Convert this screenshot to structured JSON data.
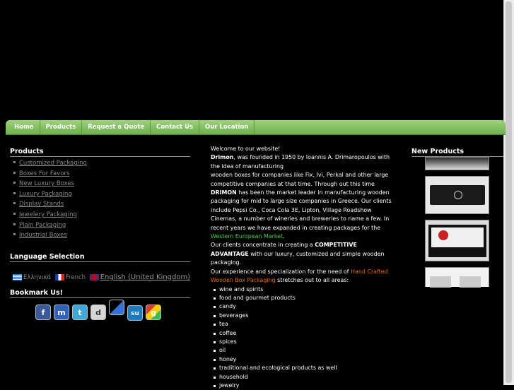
{
  "nav": [
    "Home",
    "Products",
    "Request a Quote",
    "Contact Us",
    "Our Location"
  ],
  "left": {
    "products_title": "Products",
    "products": [
      "Customized Packaging",
      "Boxes For Favors",
      "New Luxury Boxes",
      "Luxury Packaging",
      "Display Stands",
      "Jewelery Packaging",
      "Plain Packaging",
      "Industrial Boxes"
    ],
    "language_title": "Language Selection",
    "languages": {
      "greek": "Ελληνικά",
      "french": "French",
      "english": "English (United Kingdom)"
    },
    "bookmark_title": "Bookmark Us!",
    "bookmark_icons": [
      "facebook-icon",
      "myspace-icon",
      "twitter-icon",
      "digg-icon",
      "delicious-icon",
      "stumbleupon-icon",
      "google-icon"
    ]
  },
  "main": {
    "welcome": "Welcome to our website!",
    "brand1": "Drimon",
    "text1": ", was founded in 1950 by Ioannis A. Drimaropoulos with the idea of manufacturing",
    "text2": "wooden boxes for companies like Fix, Ivi, Perkal and other large competitive companies at that time. Through out this time",
    "brand2": "DRIMON",
    "text3": "has been the market leader in manufacturing wooden packaging for mid to large size companies in Greece. Our clients include Pepsi Co., Coca Cola 3E, Lipton, Village Roadshow Cinemas, a number of wineries and breweries to name a few. In recent years we have expanded in creating packages for the",
    "western_link": "Western European Market",
    "text4": "Our clients concentrate in creating a",
    "competitive": "COMPETITIVE ADVANTAGE",
    "text5": "with our luxury, customized and simple wooden packaging.",
    "text6": "Our experience and specialization for the need of",
    "handcrafted_link": "Hand Crafted Wooden Box Packaging",
    "text7": "stretches out to all areas:",
    "areas": [
      "wine and spirits",
      "food and gourmet products",
      "candy",
      "beverages",
      "tea",
      "coffee",
      "spices",
      "oil",
      "honey",
      "traditional and ecological products as well",
      "household",
      "jewelry"
    ]
  },
  "right": {
    "new_products_title": "New Products"
  },
  "colors": {
    "nav_green": "#86c263",
    "link_green": "#4cd24c",
    "link_orange": "#e86a17"
  }
}
